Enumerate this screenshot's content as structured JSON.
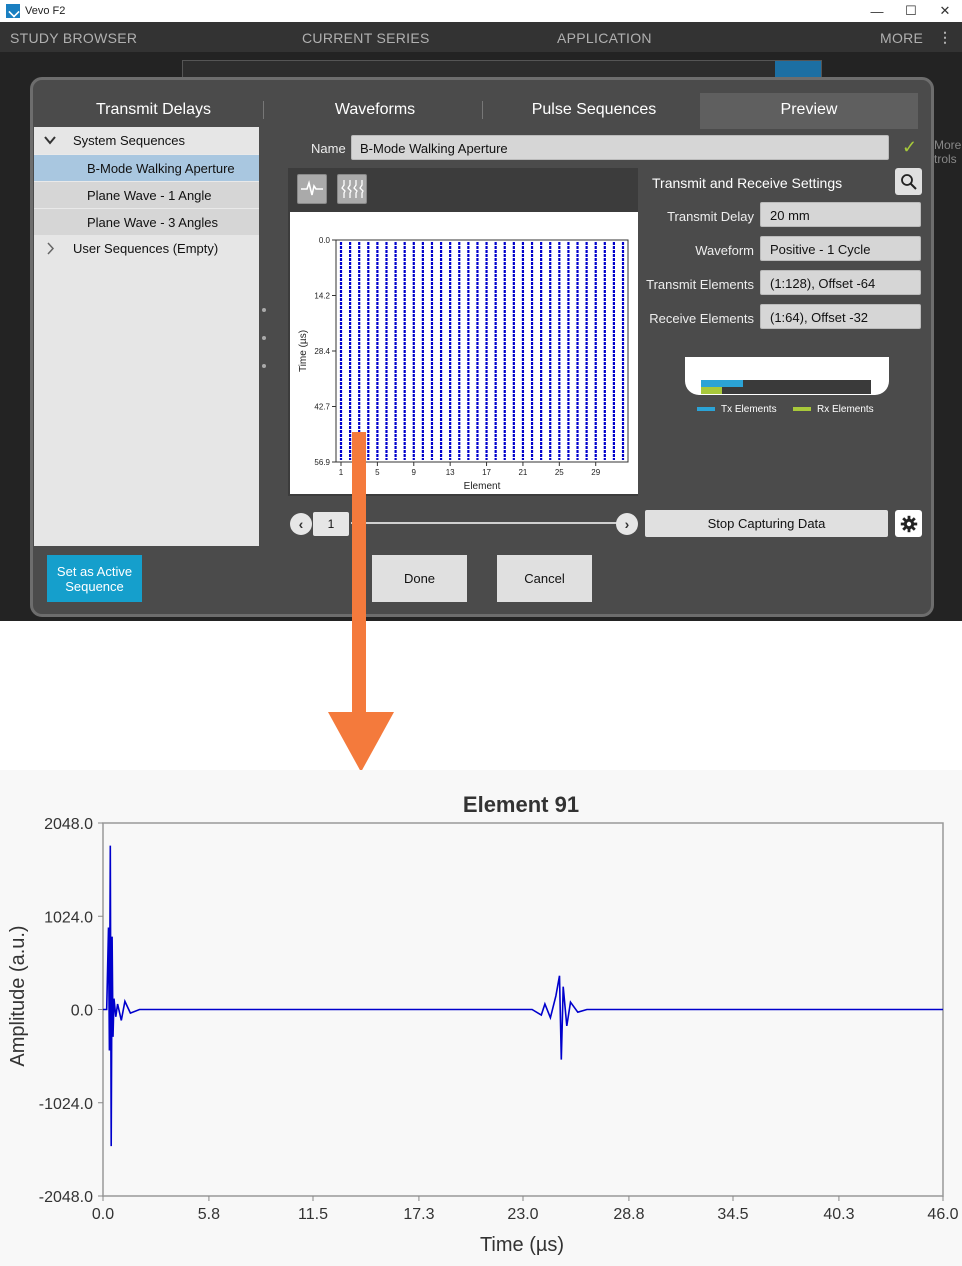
{
  "window": {
    "title": "Vevo F2",
    "controls": [
      "—",
      "☐",
      "✕"
    ]
  },
  "topnav": {
    "items": [
      "STUDY BROWSER",
      "CURRENT SERIES",
      "APPLICATION",
      "MORE"
    ],
    "more_icon": "⋮"
  },
  "background": {
    "more_controls": [
      "More",
      "trols"
    ]
  },
  "dialog": {
    "tabs": [
      "Transmit Delays",
      "Waveforms",
      "Pulse Sequences",
      "Preview"
    ],
    "active_tab": "Preview",
    "tree": {
      "system_group": "System Sequences",
      "system_items": [
        "B-Mode Walking Aperture",
        "Plane Wave - 1 Angle",
        "Plane Wave - 3 Angles"
      ],
      "selected": "B-Mode Walking Aperture",
      "user_group": "User Sequences (Empty)"
    },
    "name_label": "Name",
    "name_value": "B-Mode Walking Aperture",
    "settings_title": "Transmit and Receive Settings",
    "settings": [
      {
        "label": "Transmit Delay",
        "value": "20 mm"
      },
      {
        "label": "Waveform",
        "value": "Positive - 1 Cycle"
      },
      {
        "label": "Transmit Elements",
        "value": "(1:128), Offset -64"
      },
      {
        "label": "Receive Elements",
        "value": "(1:64), Offset -32"
      }
    ],
    "legend": {
      "tx": "Tx Elements",
      "rx": "Rx Elements"
    },
    "page": "1",
    "stop_button": "Stop Capturing Data",
    "buttons": {
      "set_active": "Set as Active Sequence",
      "done": "Done",
      "cancel": "Cancel"
    }
  },
  "preview_chart": {
    "type": "line",
    "xlabel": "Element",
    "ylabel": "Time (µs)",
    "x_ticks": [
      "1",
      "5",
      "9",
      "13",
      "17",
      "21",
      "25",
      "29"
    ],
    "y_ticks": [
      "0.0",
      "14.2",
      "28.4",
      "42.7",
      "56.9"
    ],
    "element_count": 32,
    "color": "#0000cc"
  },
  "arrow_color": "#f47a3c",
  "chart_data": {
    "type": "line",
    "title": "Element 91",
    "xlabel": "Time (µs)",
    "ylabel": "Amplitude (a.u.)",
    "xlim": [
      0.0,
      46.0
    ],
    "ylim": [
      -2048.0,
      2048.0
    ],
    "x_ticks": [
      "0.0",
      "5.8",
      "11.5",
      "17.3",
      "23.0",
      "28.8",
      "34.5",
      "40.3",
      "46.0"
    ],
    "y_ticks": [
      "2048.0",
      "1024.0",
      "0.0",
      "-1024.0",
      "-2048.0"
    ],
    "series": [
      {
        "color": "#0000cc",
        "x": [
          0.0,
          0.2,
          0.3,
          0.35,
          0.4,
          0.45,
          0.5,
          0.55,
          0.6,
          0.7,
          0.8,
          1.0,
          1.2,
          1.5,
          2.0,
          5.0,
          10.0,
          15.0,
          20.0,
          23.5,
          24.0,
          24.2,
          24.5,
          24.8,
          25.0,
          25.1,
          25.2,
          25.4,
          25.6,
          26.0,
          26.5,
          30.0,
          35.0,
          40.0,
          46.0
        ],
        "y": [
          0,
          0,
          900,
          -450,
          1800,
          -1500,
          800,
          -300,
          120,
          -80,
          60,
          -120,
          90,
          -40,
          0,
          0,
          0,
          0,
          0,
          0,
          -60,
          60,
          -90,
          150,
          370,
          -550,
          250,
          -180,
          80,
          -30,
          0,
          0,
          0,
          0,
          0
        ]
      }
    ]
  }
}
